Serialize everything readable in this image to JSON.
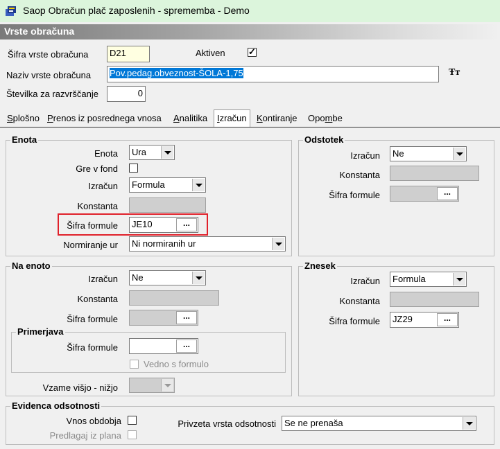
{
  "window": {
    "title": "Saop Obračun plač zaposlenih - sprememba - Demo",
    "icon": "app-icon"
  },
  "header": {
    "section": "Vrste obračuna"
  },
  "top": {
    "sifra_label": "Šifra vrste obračuna",
    "sifra_value": "D21",
    "aktiven_label": "Aktiven",
    "aktiven_checked": true,
    "naziv_label": "Naziv vrste obračuna",
    "naziv_value": "Pov.pedag.obveznost-ŠOLA-1,75",
    "stevilka_label": "Številka  za razvrščanje",
    "stevilka_value": "0",
    "font_icon": "font-tt-icon"
  },
  "tabs": [
    {
      "label": "Splošno"
    },
    {
      "label": "Prenos iz posrednega vnosa"
    },
    {
      "label": "Analitika"
    },
    {
      "label": "Izračun",
      "active": true
    },
    {
      "label": "Kontiranje"
    },
    {
      "label": "Opombe"
    }
  ],
  "enota": {
    "caption": "Enota",
    "enota_label": "Enota",
    "enota_value": "Ura",
    "grevfond_label": "Gre v fond",
    "izracun_label": "Izračun",
    "izracun_value": "Formula",
    "konstanta_label": "Konstanta",
    "sifra_formule_label": "Šifra formule",
    "sifra_formule_value": "JE10",
    "normiranje_label": "Normiranje ur",
    "normiranje_value": "Ni normiranih ur"
  },
  "odstotek": {
    "caption": "Odstotek",
    "izracun_label": "Izračun",
    "izracun_value": "Ne",
    "konstanta_label": "Konstanta",
    "sifra_formule_label": "Šifra formule"
  },
  "na_enoto": {
    "caption": "Na enoto",
    "izracun_label": "Izračun",
    "izracun_value": "Ne",
    "konstanta_label": "Konstanta",
    "sifra_formule_label": "Šifra formule",
    "primerjava_caption": "Primerjava",
    "primerjava_sifra_label": "Šifra formule",
    "vedno_label": "Vedno s formulo",
    "vzame_label": "Vzame višjo - nižjo"
  },
  "znesek": {
    "caption": "Znesek",
    "izracun_label": "Izračun",
    "izracun_value": "Formula",
    "konstanta_label": "Konstanta",
    "sifra_formule_label": "Šifra formule",
    "sifra_formule_value": "JZ29"
  },
  "evidenca": {
    "caption": "Evidenca odsotnosti",
    "vnos_label": "Vnos obdobja",
    "predlagaj_label": "Predlagaj iz plana",
    "privzeta_label": "Privzeta vrsta odsotnosti",
    "privzeta_value": "Se ne prenaša"
  },
  "lookup_button_label": "..."
}
